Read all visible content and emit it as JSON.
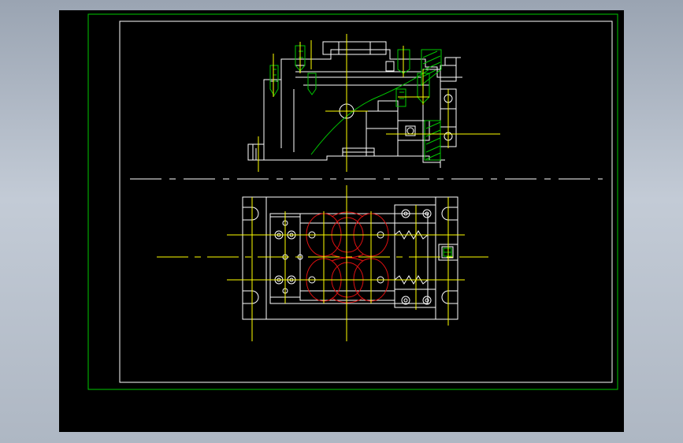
{
  "drawing": {
    "colors": {
      "background": "#000000",
      "border_outer": "#00c800",
      "border_inner": "#ffffff",
      "outline": "#ffffff",
      "centerline": "#ffff00",
      "hatch": "#00c800",
      "circles": "#e01010"
    },
    "views": [
      "top-section-view",
      "plan-view"
    ]
  }
}
